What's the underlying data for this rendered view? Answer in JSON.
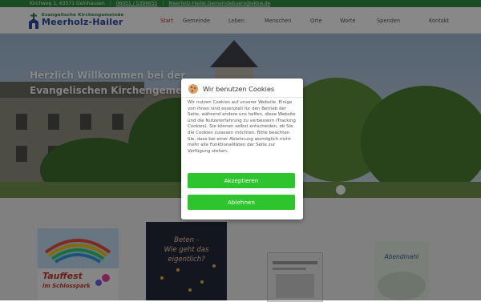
{
  "topbar": {
    "address": "Kirchweg 1, 63571 Gelnhausen",
    "phone": "06051 / 5396655",
    "email": "Meerholz-Hailer.Gemeindebuero@ekkw.de"
  },
  "logo": {
    "small": "Evangelische Kirchengemeinde",
    "big": "Meerholz-Hailer"
  },
  "menu": [
    "Start",
    "Gemeinde",
    "Leben",
    "Menschen",
    "Orte",
    "Worte",
    "Spenden",
    "Kontakt"
  ],
  "hero": {
    "line1": "Herzlich Willkommen bei der",
    "line2": "Evangelischen Kirchengemeinde Meerholz-Hailer"
  },
  "cookie": {
    "title": "Wir benutzen Cookies",
    "text": "Wir nutzen Cookies auf unserer Website. Einige von ihnen sind essenziell für den Betrieb der Seite, während andere uns helfen, diese Website und die Nutzererfahrung zu verbessern (Tracking Cookies). Sie können selbst entscheiden, ob Sie die Cookies zulassen möchten. Bitte beachten Sie, dass bei einer Ablehnung womöglich nicht mehr alle Funktionalitäten der Seite zur Verfügung stehen.",
    "accept_label": "Akzeptieren",
    "reject_label": "Ablehnen"
  },
  "cards": {
    "card1_text1": "Tauffest",
    "card1_text2": "im Schlosspark",
    "card2_text1": "Beten -",
    "card2_text2": "Wie geht das",
    "card2_text3": "eigentlich?",
    "card4_text": "Abendmahl"
  },
  "colors": {
    "topbar": "#2f8a3e",
    "active_menu": "#c52e2e",
    "button": "#2ec42e",
    "logo_blue": "#2b4aa1"
  }
}
